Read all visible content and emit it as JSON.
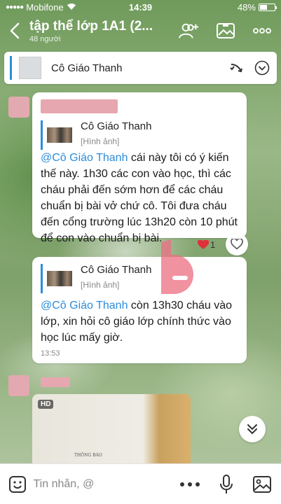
{
  "status_bar": {
    "carrier": "Mobifone",
    "time": "14:39",
    "battery": "48%",
    "battery_level": 0.48
  },
  "header": {
    "title": "tập thể lớp 1A1 (2...",
    "member_count": "48 người",
    "icons": [
      "back-icon",
      "add-member-icon",
      "gallery-icon",
      "more-icon"
    ]
  },
  "pinned": {
    "name": "Cô Giáo Thanh",
    "icons": [
      "pin-icon",
      "expand-icon"
    ]
  },
  "messages": [
    {
      "quote_name": "Cô Giáo Thanh",
      "quote_type": "[Hình ảnh]",
      "mention": "@Cô Giáo Thanh",
      "text": " cái này tôi có ý kiến thế này. 1h30 các con vào học, thì các cháu phải đến sớm hơn để các cháu chuẩn bị bài vở chứ cô. Tôi đưa cháu đến cổng trường lúc 13h20 còn 10 phút để con vào chuẩn bị bài.",
      "reaction_count": "1"
    },
    {
      "quote_name": "Cô Giáo Thanh",
      "quote_type": "[Hình ảnh]",
      "mention": "@Cô Giáo Thanh",
      "text": " còn 13h30 cháu vào lớp, xin hỏi cô giáo lớp chính thức vào học lúc mấy giờ.",
      "time": "13:53"
    }
  ],
  "image_message": {
    "badge": "HD",
    "doc_title": "THÔNG BÁO"
  },
  "input_bar": {
    "placeholder": "Tin nhắn, @",
    "icons": [
      "emoji-icon",
      "more-icon",
      "microphone-icon",
      "image-icon"
    ]
  },
  "colors": {
    "accent": "#2c8cd9",
    "redaction": "#e7a7b0",
    "heart": "#e0303a"
  }
}
